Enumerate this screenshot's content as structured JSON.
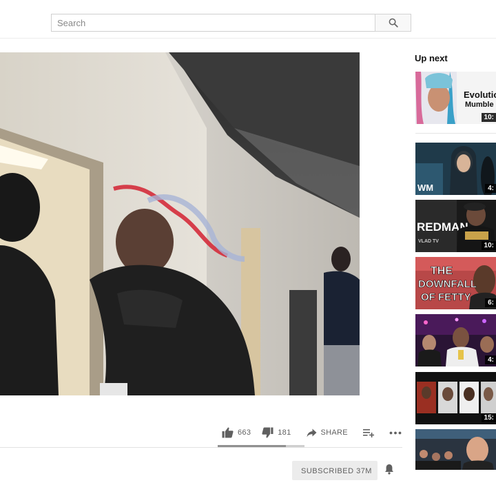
{
  "search": {
    "placeholder": "Search"
  },
  "icons": {
    "search": "search-icon",
    "like": "thumbs-up-icon",
    "dislike": "thumbs-down-icon",
    "share": "share-arrow-icon",
    "save": "playlist-add-icon",
    "more": "more-horizontal-icon",
    "bell": "bell-icon"
  },
  "video": {
    "likes": "663",
    "dislikes": "181",
    "like_ratio": 0.785,
    "share_label": "SHARE",
    "subscribe_label": "SUBSCRIBED 37M"
  },
  "sidebar": {
    "heading": "Up next",
    "items": [
      {
        "overlay": "Evolution",
        "overlay2": "Mumble R",
        "duration": "10:"
      },
      {
        "overlay": "WM",
        "duration": "4:"
      },
      {
        "overlay": "REDMAN",
        "overlay2": "VLAD TV",
        "duration": "10:"
      },
      {
        "overlay": "THE",
        "overlay2": "DOWNFALL",
        "overlay3": "OF FETTY",
        "duration": "6:"
      },
      {
        "overlay": "",
        "duration": "4:"
      },
      {
        "overlay": "",
        "duration": "15:"
      },
      {
        "overlay": "",
        "duration": ""
      }
    ]
  },
  "colors": {
    "accent_blue": "#065fd4",
    "thumb_yellow": "#ffeb3b",
    "thumb_red": "#c62828"
  }
}
